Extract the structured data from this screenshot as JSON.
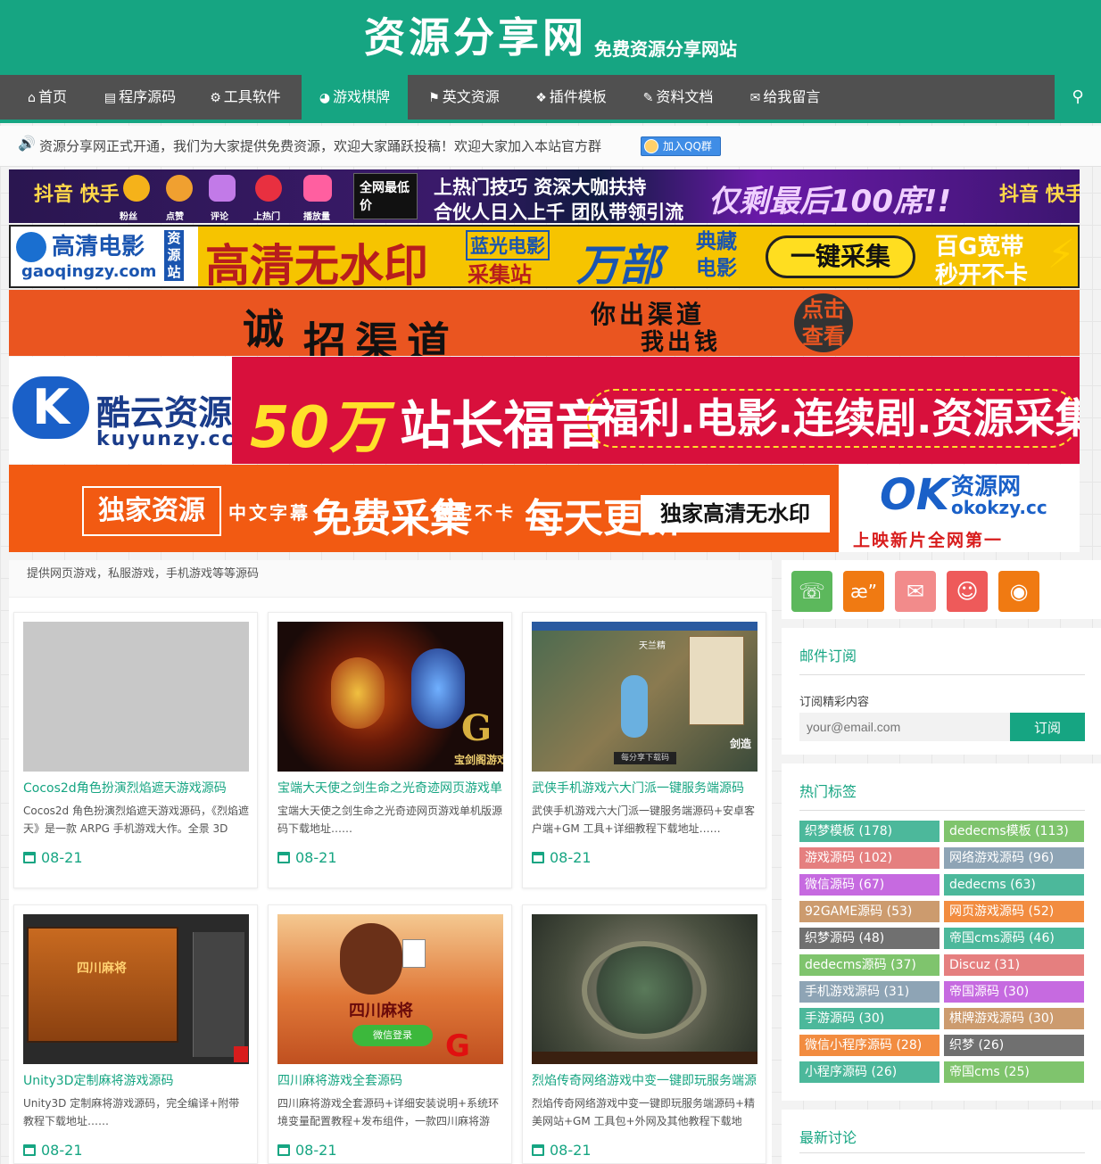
{
  "site": {
    "title": "资源分享网",
    "subtitle": "免费资源分享网站"
  },
  "nav": {
    "items": [
      {
        "icon": "home-icon",
        "glyph": "⌂",
        "label": "首页"
      },
      {
        "icon": "html5-icon",
        "glyph": "▤",
        "label": "程序源码"
      },
      {
        "icon": "gears-icon",
        "glyph": "⚙",
        "label": "工具软件"
      },
      {
        "icon": "gamepad-icon",
        "glyph": "◕",
        "label": "游戏棋牌"
      },
      {
        "icon": "flag-icon",
        "glyph": "⚑",
        "label": "英文资源"
      },
      {
        "icon": "puzzle-icon",
        "glyph": "❖",
        "label": "插件模板"
      },
      {
        "icon": "edit-icon",
        "glyph": "✎",
        "label": "资料文档"
      },
      {
        "icon": "comments-icon",
        "glyph": "✉",
        "label": "给我留言"
      }
    ],
    "active_index": 3,
    "search_glyph": "⚲"
  },
  "notice": {
    "text": "资源分享网正式开通，我们为大家提供免费资源，欢迎大家踊跃投稿！欢迎大家加入本站官方群",
    "qq_button": "加入QQ群"
  },
  "banners": {
    "b1": {
      "logo": "抖音 快手",
      "icons": [
        "粉丝",
        "点赞",
        "评论",
        "上热门",
        "播放量"
      ],
      "tiktok": "全网最低价",
      "slogan1": "上热门技巧 资深大咖扶持",
      "slogan2": "合伙人日入上千 团队带领引流",
      "promo": "仅剩最后100席!!",
      "logo2": "抖音 快手"
    },
    "b2": {
      "brand": "高清电影",
      "site_tag": "资源站",
      "domain": "gaoqingzy.com",
      "main": "高清无水印",
      "tag1": "蓝光电影",
      "tag2": "采集站",
      "count": "万部",
      "classic": "典藏 电影",
      "button": "一键采集",
      "bandwidth": "百G宽带",
      "speed": "秒开不卡"
    },
    "b3": {
      "char1": "诚",
      "main": "招渠道",
      "sub1": "你出渠道",
      "sub2": "我出钱",
      "cta": "点击 查看"
    },
    "b4": {
      "brand": "酷云资源",
      "domain": "kuyunzy.cc",
      "big": "50万",
      "news": "站长福音",
      "tags": "福利.电影.连续剧.资源采集"
    },
    "b5": {
      "exclusive": "独家资源",
      "sub": "中文字幕",
      "free": "免费采集",
      "stable": "稳定不卡",
      "daily": "每天更新",
      "hd": "独家高清无水印",
      "brand": "资源网",
      "domain": "okokzy.cc",
      "new": "上映新片全网第一"
    }
  },
  "main": {
    "category_desc": "提供网页游戏，私服游戏，手机游戏等等源码",
    "cards": [
      {
        "title": "Cocos2d角色扮演烈焰遮天游戏源码",
        "desc": "Cocos2d 角色扮演烈焰遮天游戏源码，《烈焰遮天》是一款 ARPG 手机游戏大作。全景 3D",
        "date": "08-21"
      },
      {
        "title": "宝端大天使之剑生命之光奇迹网页游戏单",
        "desc": "宝端大天使之剑生命之光奇迹网页游戏单机版源码下载地址……",
        "date": "08-21"
      },
      {
        "title": "武侠手机游戏六大门派一键服务端源码",
        "desc": "武侠手机游戏六大门派一键服务端源码+安卓客户端+GM 工具+详细教程下载地址……",
        "date": "08-21"
      },
      {
        "title": "Unity3D定制麻将游戏源码",
        "desc": "Unity3D 定制麻将游戏源码，完全编译+附带教程下载地址……",
        "date": "08-21"
      },
      {
        "title": "四川麻将游戏全套源码",
        "desc": "四川麻将游戏全套源码+详细安装说明+系统环境变量配置教程+发布组件，一款四川麻将游",
        "date": "08-21"
      },
      {
        "title": "烈焰传奇网络游戏中变一键即玩服务端源",
        "desc": "烈焰传奇网络游戏中变一键即玩服务端源码+精美网站+GM 工具包+外网及其他教程下载地",
        "date": "08-21"
      }
    ],
    "thumb_texts": {
      "card2_logo": "G",
      "card2_caption": "宝剑阁游戏精",
      "card3_title": "天兰精",
      "card3_btn": "每分享下载码",
      "card3_side": "剑造",
      "card4_title": "四川麻将",
      "card5_title": "四川麻将",
      "card5_btn": "微信登录",
      "card5_logo": "G"
    }
  },
  "sidebar": {
    "social": [
      {
        "icon": "wechat-icon",
        "glyph": "☏",
        "color": "#5cb85c"
      },
      {
        "icon": "weibo-icon",
        "glyph": "æ”",
        "color": "#f07a12"
      },
      {
        "icon": "email-icon",
        "glyph": "✉",
        "color": "#f28b8b"
      },
      {
        "icon": "qq-icon",
        "glyph": "☺",
        "color": "#ee5a5a"
      },
      {
        "icon": "rss-icon",
        "glyph": "◉",
        "color": "#f07a12"
      }
    ],
    "subscribe": {
      "title": "邮件订阅",
      "label": "订阅精彩内容",
      "placeholder": "your@email.com",
      "button": "订阅"
    },
    "tags": {
      "title": "热门标签",
      "items": [
        {
          "label": "织梦模板 (178)",
          "color": "#4cb89b"
        },
        {
          "label": "dedecms模板 (113)",
          "color": "#7fc46d"
        },
        {
          "label": "游戏源码 (102)",
          "color": "#e57f7f"
        },
        {
          "label": "网络游戏源码 (96)",
          "color": "#8ea4b5"
        },
        {
          "label": "微信源码 (67)",
          "color": "#c66ae0"
        },
        {
          "label": "dedecms (63)",
          "color": "#4cb89b"
        },
        {
          "label": "92GAME源码 (53)",
          "color": "#cc9b6e"
        },
        {
          "label": "网页游戏源码 (52)",
          "color": "#f28c40"
        },
        {
          "label": "织梦源码 (48)",
          "color": "#707070"
        },
        {
          "label": "帝国cms源码 (46)",
          "color": "#4cb89b"
        },
        {
          "label": "dedecms源码 (37)",
          "color": "#7fc46d"
        },
        {
          "label": "Discuz (31)",
          "color": "#e57f7f"
        },
        {
          "label": "手机游戏源码 (31)",
          "color": "#8ea4b5"
        },
        {
          "label": "帝国源码 (30)",
          "color": "#c66ae0"
        },
        {
          "label": "手游源码 (30)",
          "color": "#4cb89b"
        },
        {
          "label": "棋牌游戏源码 (30)",
          "color": "#cc9b6e"
        },
        {
          "label": "微信小程序源码 (28)",
          "color": "#f28c40"
        },
        {
          "label": "织梦 (26)",
          "color": "#707070"
        },
        {
          "label": "小程序源码 (26)",
          "color": "#4cb89b"
        },
        {
          "label": "帝国cms (25)",
          "color": "#7fc46d"
        }
      ]
    },
    "discussion": {
      "title": "最新讨论"
    }
  }
}
